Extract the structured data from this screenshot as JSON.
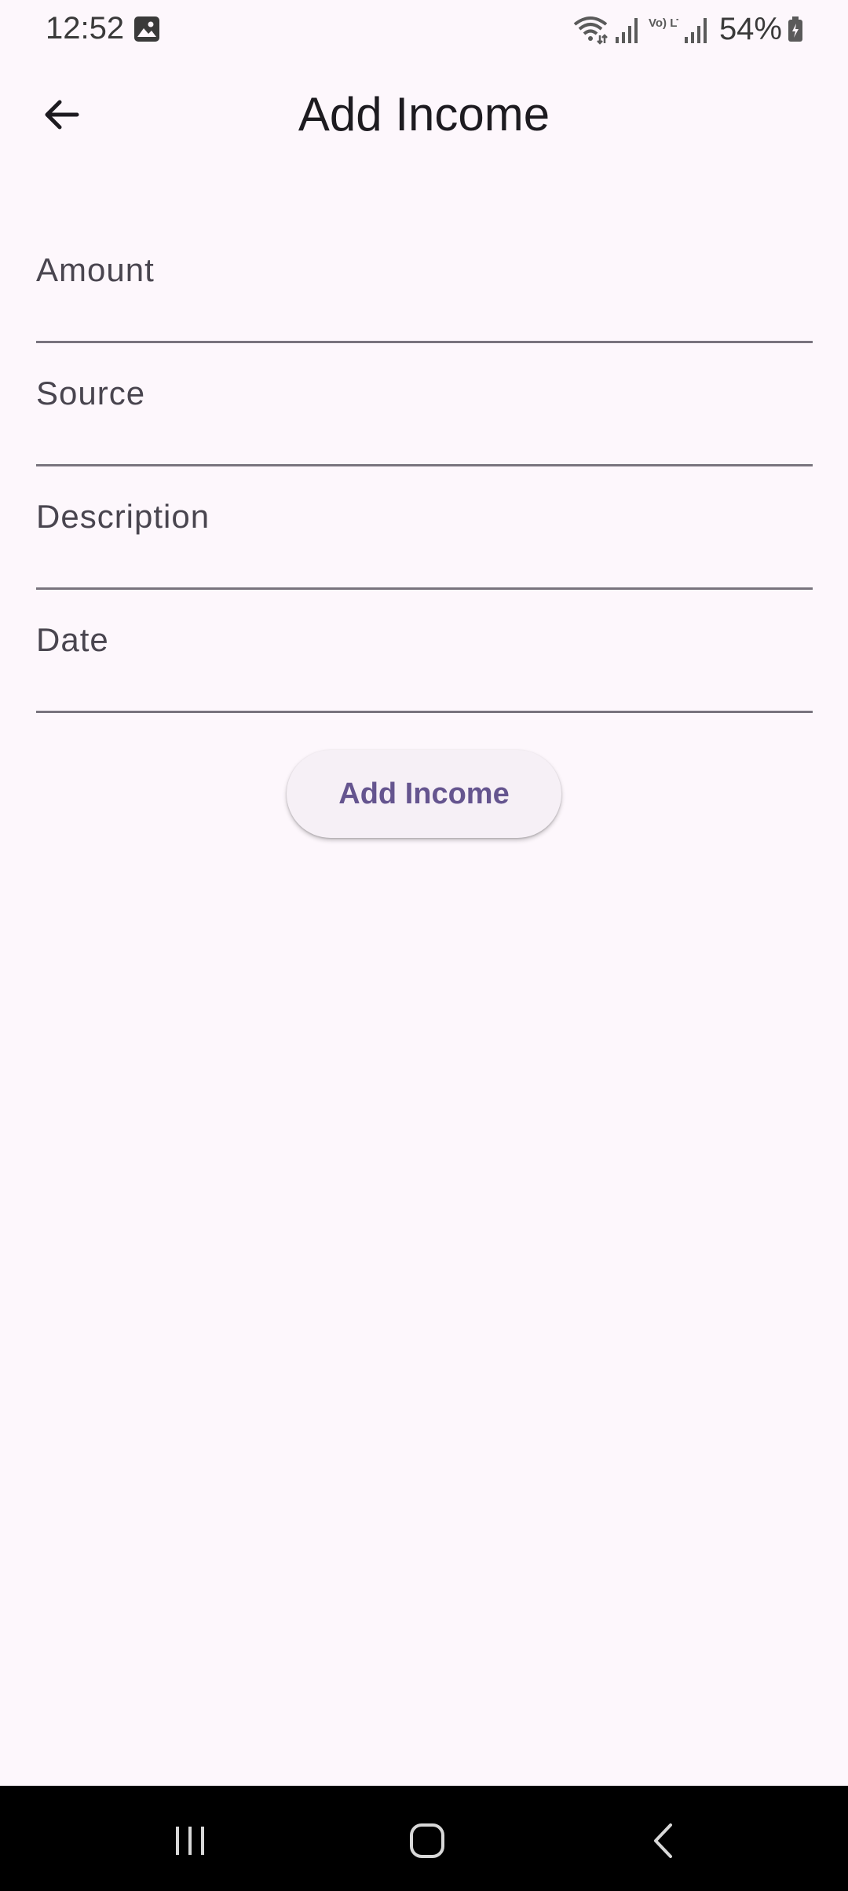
{
  "status_bar": {
    "time": "12:52",
    "battery": "54%",
    "icons": [
      "gallery-icon",
      "wifi-icon",
      "signal-icon",
      "volte-icon",
      "signal-icon",
      "battery-icon"
    ],
    "volte_text": "Vo) LTE2"
  },
  "app_bar": {
    "title": "Add Income",
    "back_icon": "arrow-back-icon"
  },
  "form": {
    "fields": [
      {
        "label": "Amount",
        "value": ""
      },
      {
        "label": "Source",
        "value": ""
      },
      {
        "label": "Description",
        "value": ""
      },
      {
        "label": "Date",
        "value": ""
      }
    ],
    "submit_label": "Add Income"
  },
  "navigation": {
    "buttons": [
      "recent-apps-icon",
      "home-icon",
      "back-icon"
    ]
  },
  "colors": {
    "background": "#fdf7fc",
    "accent": "#65558f",
    "underline": "#79747e",
    "label": "#49454f"
  }
}
